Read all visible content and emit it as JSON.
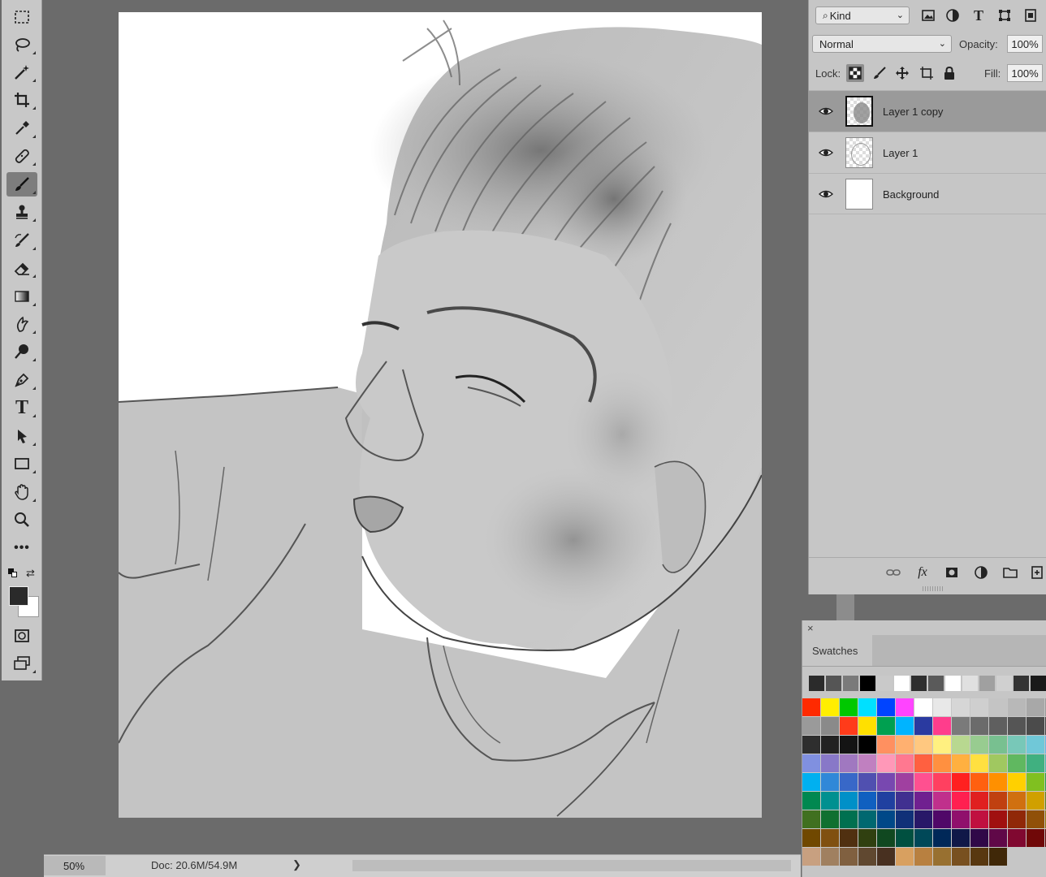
{
  "toolbar": {
    "tools": [
      {
        "name": "rectangular-marquee-tool"
      },
      {
        "name": "lasso-tool"
      },
      {
        "name": "magic-wand-tool"
      },
      {
        "name": "crop-tool"
      },
      {
        "name": "eyedropper-tool"
      },
      {
        "name": "healing-brush-tool"
      },
      {
        "name": "brush-tool",
        "active": true
      },
      {
        "name": "clone-stamp-tool"
      },
      {
        "name": "history-brush-tool"
      },
      {
        "name": "eraser-tool"
      },
      {
        "name": "gradient-tool"
      },
      {
        "name": "smudge-tool"
      },
      {
        "name": "dodge-tool"
      },
      {
        "name": "pen-tool"
      },
      {
        "name": "type-tool",
        "label": "T"
      },
      {
        "name": "path-selection-tool"
      },
      {
        "name": "rectangle-tool"
      },
      {
        "name": "hand-tool"
      },
      {
        "name": "zoom-tool"
      },
      {
        "name": "edit-toolbar",
        "label": "•••"
      }
    ],
    "foreground_color": "#2a2a2a",
    "background_color": "#ffffff"
  },
  "status": {
    "zoom": "50%",
    "doc_size": "Doc: 20.6M/54.9M",
    "arrow": "❯"
  },
  "layers_panel": {
    "filter_kind": "Kind",
    "blend_mode": "Normal",
    "opacity_label": "Opacity:",
    "opacity_value": "100%",
    "lock_label": "Lock:",
    "fill_label": "Fill:",
    "fill_value": "100%",
    "layers": [
      {
        "name": "Layer 1 copy",
        "visible": true,
        "selected": true
      },
      {
        "name": "Layer 1",
        "visible": true,
        "selected": false
      },
      {
        "name": "Background",
        "visible": true,
        "selected": false
      }
    ]
  },
  "swatches_panel": {
    "close": "×",
    "tab": "Swatches",
    "recent": [
      "#2b2b2b",
      "#555555",
      "#7a7a7a",
      "#000000",
      "#c9c9c9",
      "#ffffff",
      "#2e2e2e",
      "#5a5a5a",
      "#ffffff",
      "#e0e0e0",
      "#a0a0a0",
      "#d0d0d0",
      "#333333",
      "#1a1a1a"
    ],
    "rows": [
      [
        "#ff2a00",
        "#ffee00",
        "#00c800",
        "#00e0ff",
        "#0044ff",
        "#ff44ff",
        "#ffffff",
        "#e8e8e8",
        "#d6d6d6",
        "#cfcfcf",
        "#c4c4c4",
        "#b8b8b8",
        "#a8a8a8",
        "#9a9a9a"
      ],
      [
        "#9a9a9a",
        "#8a8a8a",
        "#ff3b1a",
        "#ffe000",
        "#00a050",
        "#00b4ff",
        "#2a3aa0",
        "#ff3d8c",
        "#7a7a7a",
        "#6b6b6b",
        "#5f5f5f",
        "#555555",
        "#4b4b4b",
        "#404040"
      ],
      [
        "#2e2e2e",
        "#222222",
        "#141414",
        "#000000",
        "#ff9060",
        "#ffb070",
        "#ffc880",
        "#fff080",
        "#b8d890",
        "#98cc90",
        "#78c090",
        "#78c8b8",
        "#70c8d8",
        "#60b8e8"
      ],
      [
        "#8090e0",
        "#8878c8",
        "#a078c0",
        "#c080c0",
        "#ff98b8",
        "#ff7890",
        "#ff6040",
        "#ff9040",
        "#ffb040",
        "#ffe040",
        "#a0c860",
        "#60b860",
        "#40b080",
        "#40b8b0"
      ],
      [
        "#00b0f0",
        "#3088d8",
        "#3868c8",
        "#5050b0",
        "#7848b0",
        "#a040a0",
        "#ff5090",
        "#ff4060",
        "#ff2020",
        "#ff6010",
        "#ff9000",
        "#ffd000",
        "#80c020",
        "#20a040"
      ],
      [
        "#008850",
        "#009090",
        "#0090c8",
        "#1060c0",
        "#2040a0",
        "#403090",
        "#702090",
        "#c0308c",
        "#ff2050",
        "#e02020",
        "#c04010",
        "#d07010",
        "#d0a000",
        "#608010"
      ],
      [
        "#407020",
        "#107030",
        "#007050",
        "#006870",
        "#004888",
        "#103078",
        "#281868",
        "#500868",
        "#90106c",
        "#c01040",
        "#a01010",
        "#902808",
        "#905008",
        "#907000"
      ],
      [
        "#704800",
        "#805010",
        "#503010",
        "#304010",
        "#104820",
        "#005040",
        "#004858",
        "#002858",
        "#101848",
        "#300848",
        "#600848",
        "#800830",
        "#700808",
        "#600000"
      ],
      [
        "#c8a080",
        "#a08060",
        "#806040",
        "#604830",
        "#483020",
        "#d8a060",
        "#b88040",
        "#987030",
        "#785020",
        "#583810",
        "#402808"
      ]
    ]
  }
}
